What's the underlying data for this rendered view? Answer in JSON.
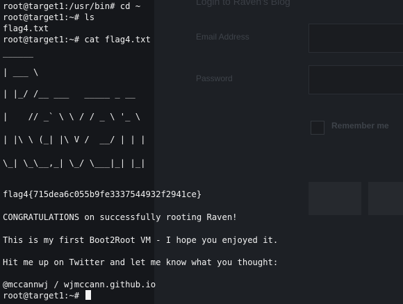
{
  "background_form": {
    "title": "Login to Raven's Blog",
    "email_label": "Email Address",
    "password_label": "Password",
    "remember_label": "Remember me"
  },
  "terminal": {
    "lines": [
      "root@target1:/usr/bin# cd ~",
      "root@target1:~# ls",
      "flag4.txt",
      "root@target1:~# cat flag4.txt",
      "______",
      "| ___ \\",
      "| |_/ /__ ___   _____ _ __",
      "|    // _` \\ \\ / / _ \\ '_ \\",
      "| |\\ \\ (_| |\\ V /  __/ | | |",
      "\\_| \\_\\__,_| \\_/ \\___|_| |_|",
      "flag4{715dea6c055b9fe3337544932f2941ce}",
      "CONGRATULATIONS on successfully rooting Raven!",
      "This is my first Boot2Root VM - I hope you enjoyed it.",
      "Hit me up on Twitter and let me know what you thought:",
      "@mccannwj / wjmccann.github.io",
      "root@target1:~# "
    ]
  },
  "colors": {
    "terminal_text": "#f1f1f1",
    "terminal_bg": "#15171b"
  }
}
